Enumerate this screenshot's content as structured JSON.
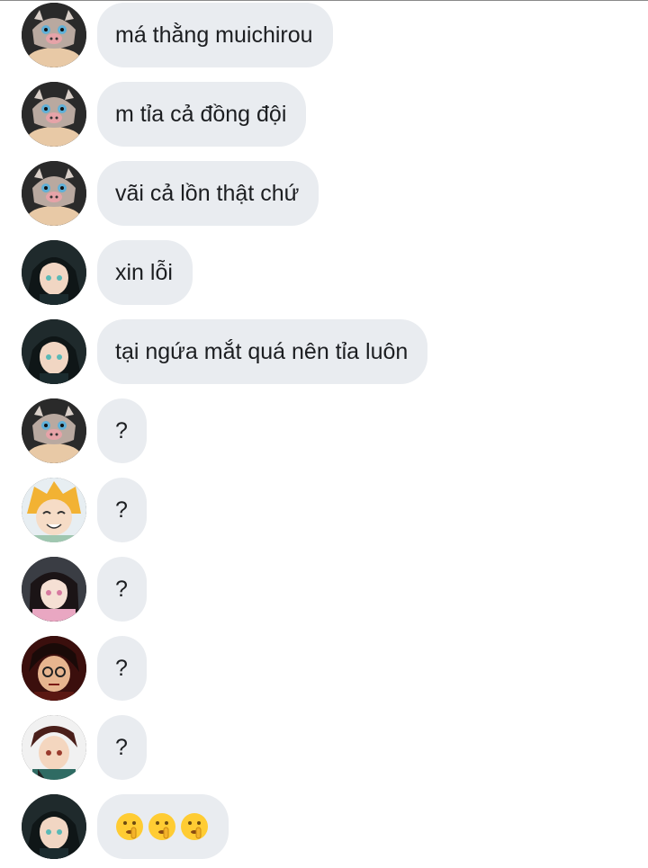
{
  "messages": [
    {
      "sender": "inosuke",
      "text": "má thằng muichirou"
    },
    {
      "sender": "inosuke",
      "text": "m tỉa cả đồng đội"
    },
    {
      "sender": "inosuke",
      "text": "vãi cả lồn thật chứ"
    },
    {
      "sender": "muichiro",
      "text": "xin lỗi"
    },
    {
      "sender": "muichiro",
      "text": "tại ngứa mắt quá nên tỉa luôn"
    },
    {
      "sender": "inosuke",
      "text": "?"
    },
    {
      "sender": "zenitsu",
      "text": "?"
    },
    {
      "sender": "nezuko",
      "text": "?"
    },
    {
      "sender": "demon",
      "text": "?"
    },
    {
      "sender": "tanjiro",
      "text": "?"
    },
    {
      "sender": "muichiro",
      "emoji": [
        "shushing-face",
        "shushing-face",
        "shushing-face"
      ]
    }
  ],
  "colors": {
    "bubble": "#e9ecf0",
    "text": "#1c1e21"
  }
}
